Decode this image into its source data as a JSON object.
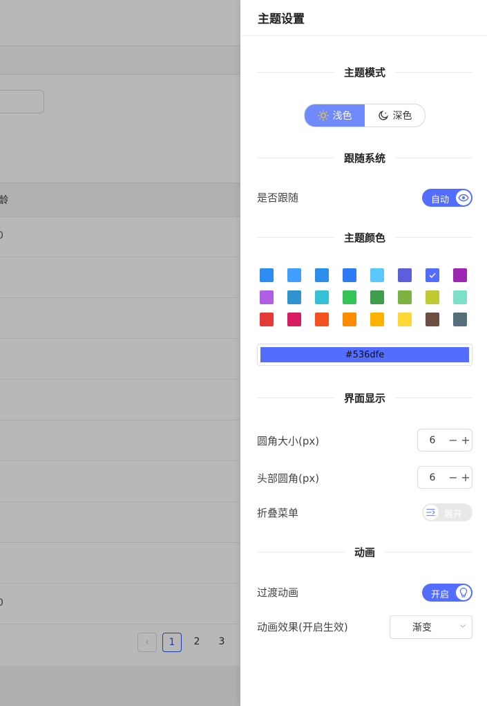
{
  "background": {
    "table_header": "龄",
    "row_suffix_1": "0",
    "row_suffix_2": "...",
    "pagination": {
      "pages": [
        "1",
        "2",
        "3"
      ],
      "current": "1"
    }
  },
  "drawer": {
    "title": "主题设置",
    "theme_mode": {
      "heading": "主题模式",
      "options": [
        {
          "label": "浅色",
          "icon": "sun-icon",
          "active": true
        },
        {
          "label": "深色",
          "icon": "moon-icon",
          "active": false
        }
      ]
    },
    "follow_system": {
      "heading": "跟随系统",
      "label": "是否跟随",
      "switch_text": "自动",
      "switch_icon": "eye-icon",
      "on": true
    },
    "theme_color": {
      "heading": "主题颜色",
      "swatches": [
        "#2d8cf0",
        "#409eff",
        "#2b8eea",
        "#2f7bf6",
        "#5ac8fa",
        "#5c5edc",
        "#536dfe",
        "#9c27b0",
        "#b05ee2",
        "#2f93cd",
        "#36c0d6",
        "#37c25a",
        "#3e9e4c",
        "#7cb342",
        "#c0ca33",
        "#7de0c8",
        "#e53935",
        "#d81b60",
        "#f4511e",
        "#fb8c00",
        "#ffb300",
        "#fdd835",
        "#6d4c41",
        "#546e7a"
      ],
      "selected": "#536dfe",
      "current_value": "#536dfe"
    },
    "interface": {
      "heading": "界面显示",
      "radius_label": "圆角大小(px)",
      "radius_value": "6",
      "header_radius_label": "头部圆角(px)",
      "header_radius_value": "6",
      "collapse_label": "折叠菜单",
      "collapse_switch_text": "展开",
      "collapse_icon": "menu-fold-icon",
      "collapse_on": false
    },
    "animation": {
      "heading": "动画",
      "transition_label": "过渡动画",
      "transition_switch_text": "开启",
      "transition_icon": "lightbulb-icon",
      "transition_on": true,
      "effect_label": "动画效果(开启生效)",
      "effect_value": "渐变"
    }
  }
}
